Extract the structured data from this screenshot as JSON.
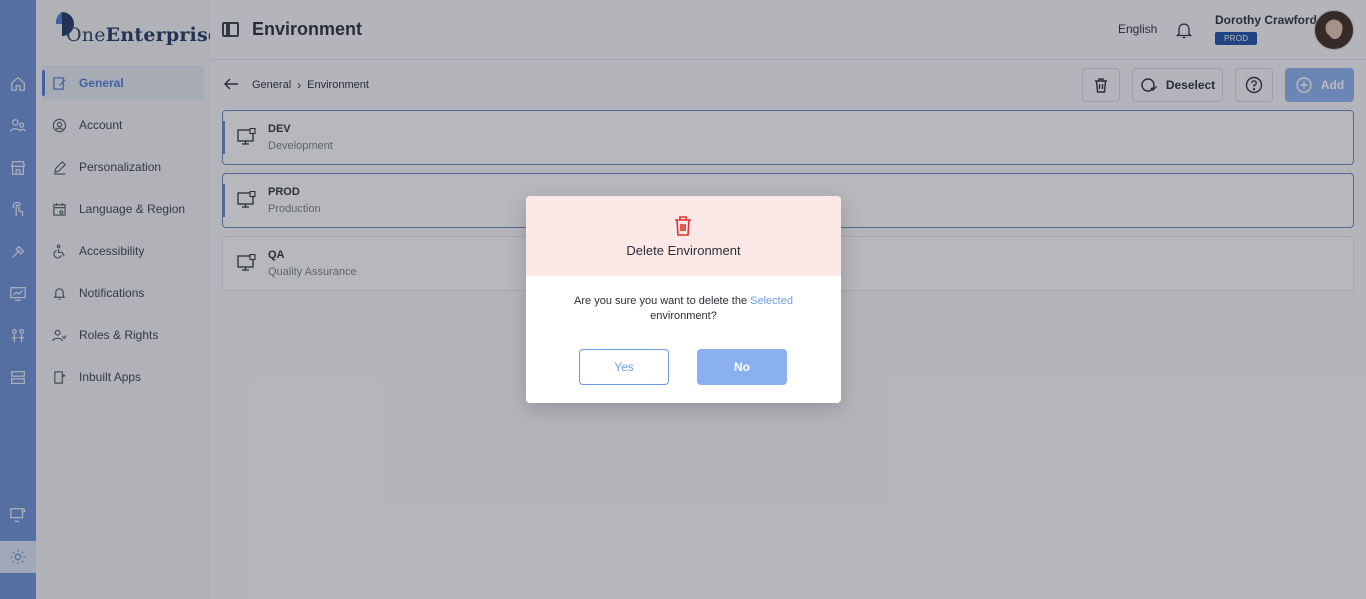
{
  "app": {
    "brand_prefix": "One",
    "brand_suffix": "Enterprise"
  },
  "colors": {
    "accent": "#6c8fd8",
    "primary_button": "#8bb0f0",
    "badge": "#1c4fa8",
    "danger": "#e0332f",
    "modal_header": "#fde8e8"
  },
  "rail": {
    "icons": [
      "home-icon",
      "users-icon",
      "store-icon",
      "touch-icon",
      "tools-icon",
      "monitor-chart-icon",
      "people-icon",
      "server-icon",
      "monitor-settings-icon",
      "settings-icon"
    ],
    "active": "settings-icon"
  },
  "sidebar": {
    "items": [
      {
        "label": "General",
        "icon": "edit-document-icon",
        "active": true
      },
      {
        "label": "Account",
        "icon": "user-circle-icon"
      },
      {
        "label": "Personalization",
        "icon": "pencil-icon"
      },
      {
        "label": "Language & Region",
        "icon": "calendar-icon"
      },
      {
        "label": "Accessibility",
        "icon": "wheelchair-icon"
      },
      {
        "label": "Notifications",
        "icon": "bell-settings-icon"
      },
      {
        "label": "Roles & Rights",
        "icon": "user-role-icon"
      },
      {
        "label": "Inbuilt Apps",
        "icon": "app-icon"
      }
    ]
  },
  "header": {
    "title": "Environment",
    "language": "English",
    "user_name": "Dorothy Crawford",
    "env_badge": "PROD"
  },
  "breadcrumb": {
    "parent": "General",
    "current": "Environment"
  },
  "toolbar": {
    "deselect_label": "Deselect",
    "add_label": "Add"
  },
  "environments": [
    {
      "code": "DEV",
      "name": "Development",
      "selected": true
    },
    {
      "code": "PROD",
      "name": "Production",
      "selected": true
    },
    {
      "code": "QA",
      "name": "Quality Assurance",
      "selected": false
    }
  ],
  "modal": {
    "title": "Delete Environment",
    "message_prefix": "Are you sure you want to delete the",
    "message_highlight": "Selected",
    "message_suffix": "environment?",
    "yes_label": "Yes",
    "no_label": "No"
  }
}
